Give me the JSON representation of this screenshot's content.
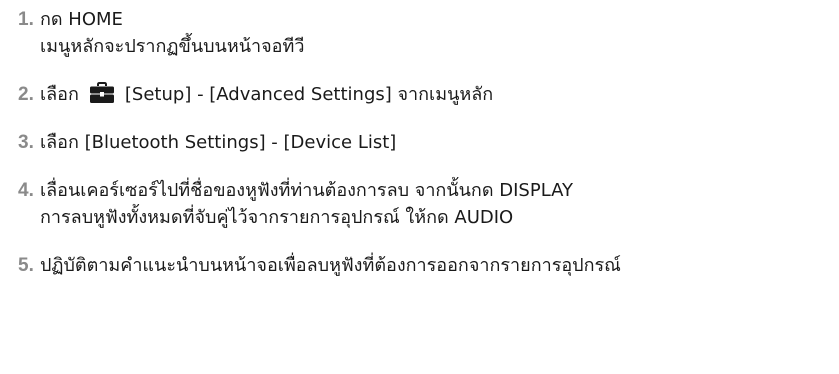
{
  "steps": [
    {
      "number": "1.",
      "lines": [
        "กด HOME",
        "เมนูหลักจะปรากฏขึ้นบนหน้าจอทีวี"
      ]
    },
    {
      "number": "2.",
      "before_icon": "เลือก",
      "icon": "toolbox-icon",
      "after_icon": "[Setup] - [Advanced Settings] จากเมนูหลัก"
    },
    {
      "number": "3.",
      "lines": [
        "เลือก [Bluetooth Settings] - [Device List]"
      ]
    },
    {
      "number": "4.",
      "lines": [
        "เลื่อนเคอร์เซอร์ไปที่ชื่อของหูฟังที่ท่านต้องการลบ จากนั้นกด DISPLAY",
        "การลบหูฟังทั้งหมดที่จับคู่ไว้จากรายการอุปกรณ์ ให้กด AUDIO"
      ]
    },
    {
      "number": "5.",
      "lines": [
        "ปฏิบัติตามคำแนะนำบนหน้าจอเพื่อลบหูฟังที่ต้องการออกจากรายการอุปกรณ์"
      ]
    }
  ],
  "colors": {
    "step_number": "#8a8a8a",
    "text": "#1a1a1a",
    "icon": "#1a1a1a"
  }
}
